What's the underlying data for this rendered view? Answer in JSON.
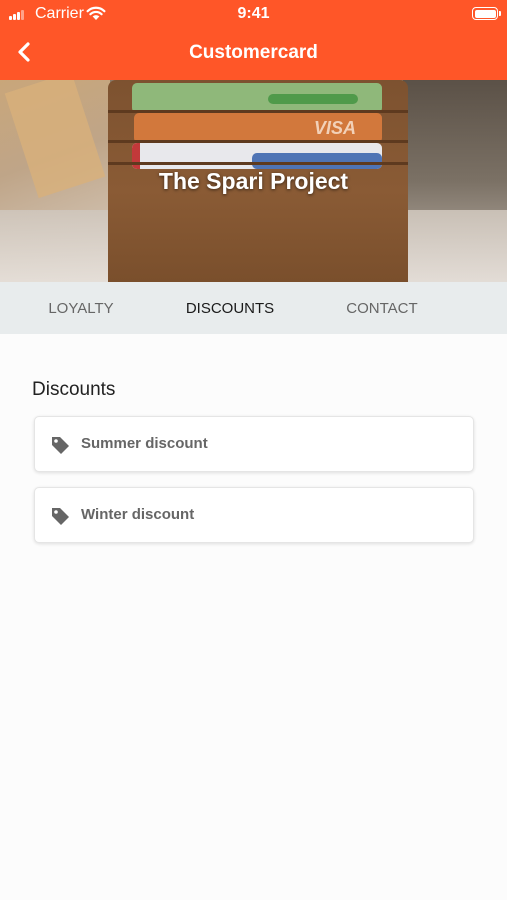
{
  "status_bar": {
    "carrier": "Carrier",
    "time": "9:41"
  },
  "nav": {
    "title": "Customercard",
    "back_icon": "chevron-left-icon"
  },
  "hero": {
    "title": "The Spari Project",
    "card_brand": "VISA"
  },
  "tabs": [
    {
      "label": "LOYALTY",
      "active": false
    },
    {
      "label": "DISCOUNTS",
      "active": true
    },
    {
      "label": "CONTACT",
      "active": false
    }
  ],
  "discounts": {
    "heading": "Discounts",
    "items": [
      {
        "label": "Summer discount",
        "icon": "tag-icon"
      },
      {
        "label": "Winter discount",
        "icon": "tag-icon"
      }
    ]
  },
  "colors": {
    "accent": "#ff5628",
    "tab_background": "#e8eced",
    "page_background": "#fcfcfc"
  }
}
